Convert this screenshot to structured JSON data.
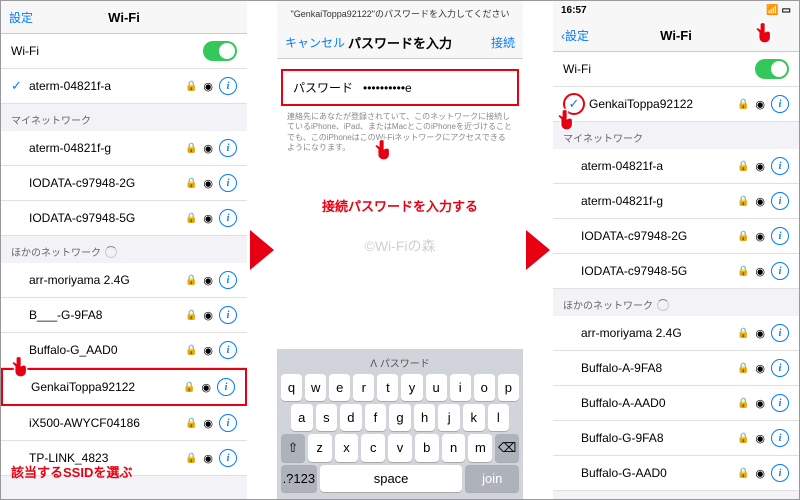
{
  "labels": {
    "settings": "設定",
    "wifi": "Wi-Fi",
    "cancel": "キャンセル",
    "connect": "接続",
    "enterpw": "パスワードを入力",
    "pwlabel": "パスワード",
    "time": "16:57",
    "join": "join",
    "space": "space"
  },
  "pane1": {
    "connected": "aterm-04821f-a",
    "sections": {
      "my": "マイネットワーク",
      "other": "ほかのネットワーク"
    },
    "myNets": [
      "aterm-04821f-g",
      "IODATA-c97948-2G",
      "IODATA-c97948-5G"
    ],
    "otherNets": [
      "arr-moriyama 2.4G",
      "B___-G-9FA8",
      "Buffalo-G_AAD0",
      "GenkaiToppa92122",
      "iX500-AWYCF04186",
      "TP-LINK_4823"
    ],
    "target": "GenkaiToppa92122"
  },
  "pane2": {
    "prompt": "\"GenkaiToppa92122\"のパスワードを入力してください",
    "pwmask": "••••••••••e",
    "note": "連絡先にあなたが登録されていて、このネットワークに接続しているiPhone、iPad、またはMacとこのiPhoneを近づけることでも、このiPhoneはこのWi-Fiネットワークにアクセスできるようになります。",
    "keys1": [
      "q",
      "w",
      "e",
      "r",
      "t",
      "y",
      "u",
      "i",
      "o",
      "p"
    ],
    "keys2": [
      "a",
      "s",
      "d",
      "f",
      "g",
      "h",
      "j",
      "k",
      "l"
    ],
    "keys3": [
      "⇧",
      "z",
      "x",
      "c",
      "v",
      "b",
      "n",
      "m",
      "⌫"
    ],
    "keysB": [
      ".?123",
      "space",
      "join"
    ]
  },
  "pane3": {
    "connected": "GenkaiToppa92122",
    "sections": {
      "my": "マイネットワーク",
      "other": "ほかのネットワーク"
    },
    "myNets": [
      "aterm-04821f-a",
      "aterm-04821f-g",
      "IODATA-c97948-2G",
      "IODATA-c97948-5G"
    ],
    "otherNets": [
      "arr-moriyama 2.4G",
      "Buffalo-A-9FA8",
      "Buffalo-A-AAD0",
      "Buffalo-G-9FA8",
      "Buffalo-G-AAD0"
    ]
  },
  "captions": {
    "p1": "該当するSSIDを選ぶ",
    "p2": "接続パスワードを入力する"
  },
  "watermark": "©Wi-Fiの森"
}
